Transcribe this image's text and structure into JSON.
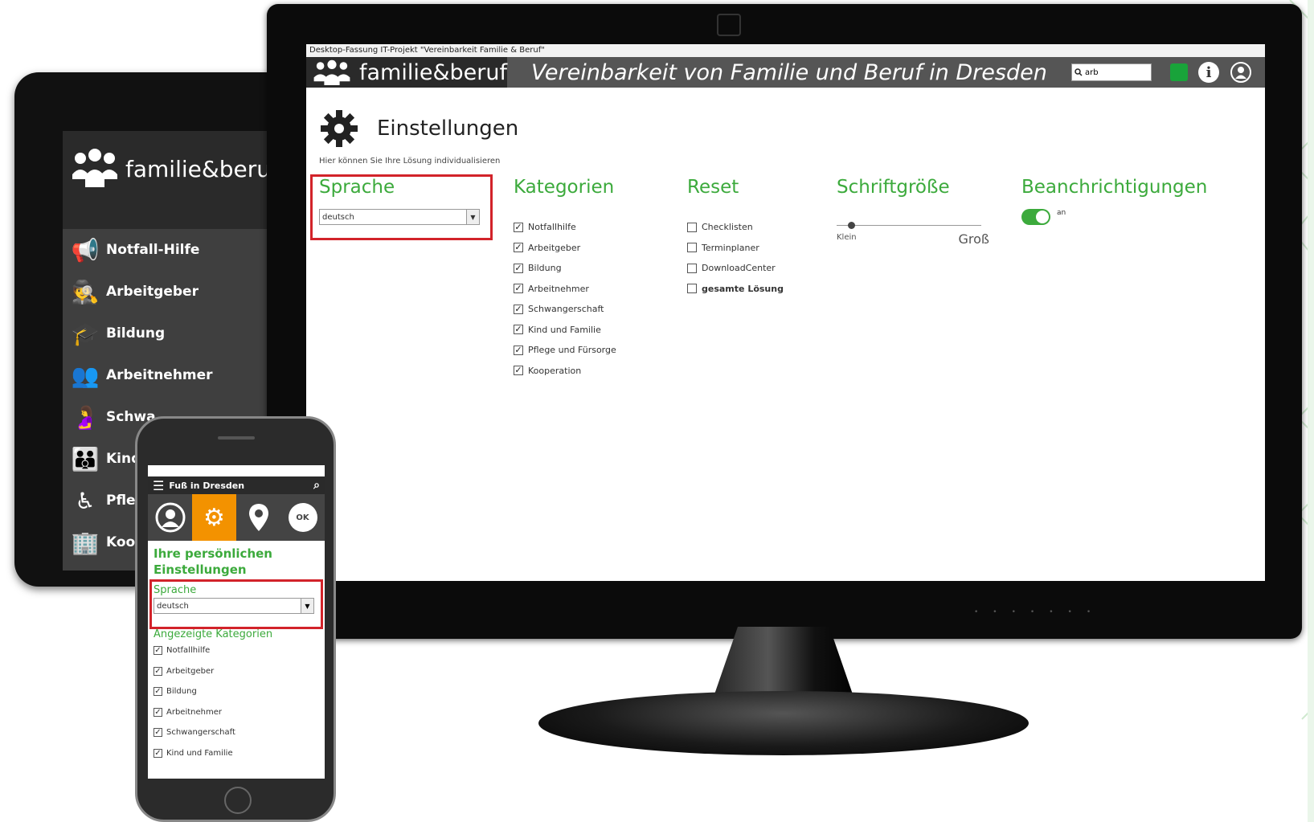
{
  "colors": {
    "accent_green": "#3caa3c",
    "highlight_red": "#d2232a",
    "active_orange": "#f39200"
  },
  "monitor": {
    "window_title": "Desktop-Fassung IT-Projekt \"Vereinbarkeit Familie & Beruf\"",
    "brand": "familie&beruf",
    "tagline": "Vereinbarkeit von Familie und Beruf in Dresden",
    "search_value": "arb",
    "page_title": "Einstellungen",
    "page_subtitle": "Hier können Sie Ihre Lösung individualisieren",
    "sprache": {
      "heading": "Sprache",
      "selected": "deutsch"
    },
    "kategorien": {
      "heading": "Kategorien",
      "items": [
        {
          "label": "Notfallhilfe",
          "checked": true
        },
        {
          "label": "Arbeitgeber",
          "checked": true
        },
        {
          "label": "Bildung",
          "checked": true
        },
        {
          "label": "Arbeitnehmer",
          "checked": true
        },
        {
          "label": "Schwangerschaft",
          "checked": true
        },
        {
          "label": "Kind und Familie",
          "checked": true
        },
        {
          "label": "Pflege und Fürsorge",
          "checked": true
        },
        {
          "label": "Kooperation",
          "checked": true
        }
      ]
    },
    "reset": {
      "heading": "Reset",
      "items": [
        {
          "label": "Checklisten",
          "checked": false
        },
        {
          "label": "Terminplaner",
          "checked": false
        },
        {
          "label": "DownloadCenter",
          "checked": false
        },
        {
          "label": "gesamte Lösung",
          "checked": false
        }
      ]
    },
    "schriftgroesse": {
      "heading": "Schriftgröße",
      "min_label": "Klein",
      "max_label": "Groß",
      "level": 0.08
    },
    "benachrichtigungen": {
      "heading": "Beanchrichtigungen",
      "toggle_label": "an",
      "on": true
    }
  },
  "tablet": {
    "brand": "familie&beruf",
    "menu": [
      {
        "label": "Notfall-Hilfe",
        "icon": "megaphone-icon"
      },
      {
        "label": "Arbeitgeber",
        "icon": "employer-icon"
      },
      {
        "label": "Bildung",
        "icon": "graduation-cap-icon"
      },
      {
        "label": "Arbeitnehmer",
        "icon": "people-icon"
      },
      {
        "label": "Schwa",
        "icon": "pregnancy-icon"
      },
      {
        "label": "Kind",
        "icon": "child-icon"
      },
      {
        "label": "Pfle",
        "icon": "wheelchair-icon"
      },
      {
        "label": "Koo",
        "icon": "building-icon"
      }
    ]
  },
  "phone": {
    "bar_title": "Fuß in Dresden",
    "icons": [
      "user-icon",
      "gear-icon",
      "location-pin-icon",
      "ok-icon"
    ],
    "ok_label": "OK",
    "title": "Ihre persönlichen Einstellungen",
    "sprache_label": "Sprache",
    "sprache_value": "deutsch",
    "categories_label": "Angezeigte Kategorien",
    "categories": [
      {
        "label": "Notfallhilfe",
        "checked": true
      },
      {
        "label": "Arbeitgeber",
        "checked": true
      },
      {
        "label": "Bildung",
        "checked": true
      },
      {
        "label": "Arbeitnehmer",
        "checked": true
      },
      {
        "label": "Schwangerschaft",
        "checked": true
      },
      {
        "label": "Kind und Familie",
        "checked": true
      }
    ]
  }
}
